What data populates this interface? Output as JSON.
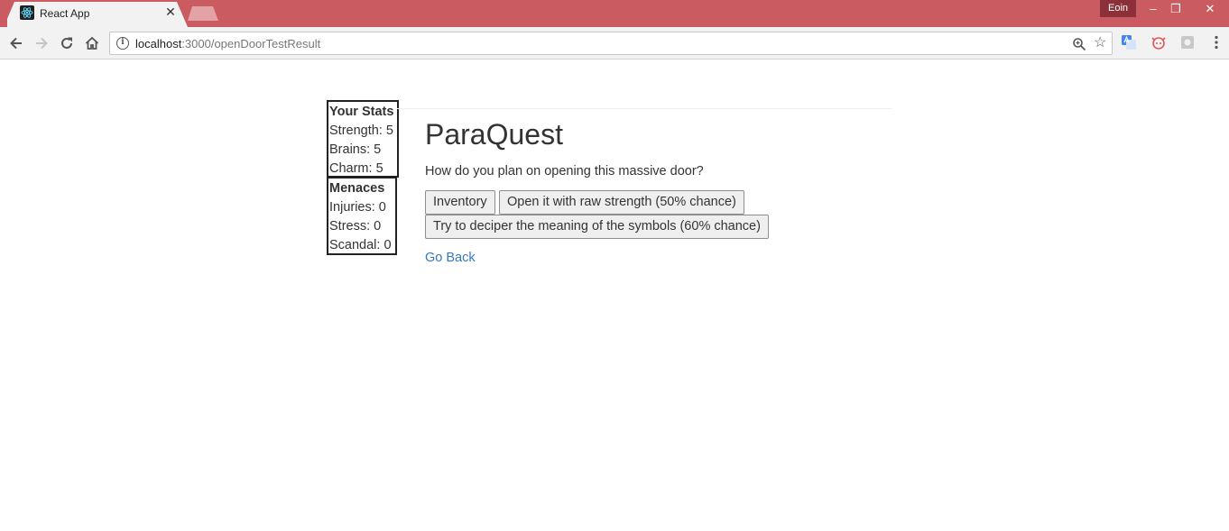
{
  "browser": {
    "tab_title": "React App",
    "tab_close": "✕",
    "profile_name": "Eoin",
    "window_controls": {
      "minimize": "–",
      "restore": "❐",
      "close": "✕"
    },
    "url_host": "localhost",
    "url_rest": ":3000/openDoorTestResult",
    "icons": {
      "back": "back-arrow-icon",
      "forward": "forward-arrow-icon",
      "reload": "reload-icon",
      "home": "home-icon",
      "info": "info-icon",
      "zoom": "zoom-icon",
      "bookmark": "star-icon",
      "extensions": [
        "translate-icon",
        "extension-cat-icon",
        "extension-grey-icon"
      ],
      "menu": "kebab-menu-icon"
    },
    "colors": {
      "titlebar": "#c95b61",
      "profile_badge": "#8b3038"
    }
  },
  "stats": {
    "title": "Your Stats",
    "items": [
      "Strength: 5",
      "Brains: 5",
      "Charm: 5"
    ]
  },
  "menaces": {
    "title": "Menaces",
    "items": [
      "Injuries: 0",
      "Stress: 0",
      "Scandal: 0"
    ]
  },
  "main": {
    "heading": "ParaQuest",
    "question": "How do you plan on opening this massive door?",
    "buttons": {
      "inventory": "Inventory",
      "strength": "Open it with raw strength (50% chance)",
      "decipher": "Try to deciper the meaning of the symbols (60% chance)"
    },
    "go_back": "Go Back",
    "link_color": "#337ab7"
  }
}
